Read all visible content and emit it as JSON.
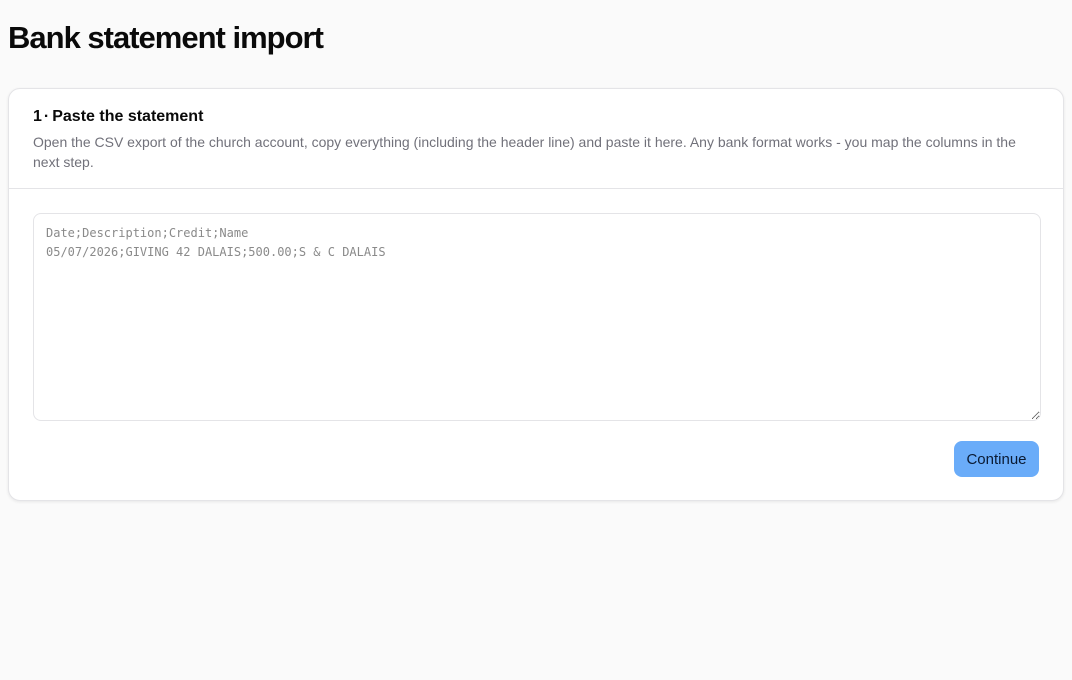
{
  "page": {
    "title": "Bank statement import"
  },
  "step": {
    "number": "1",
    "separator": "·",
    "title": "Paste the statement",
    "description": "Open the CSV export of the church account, copy everything (including the header line) and paste it here. Any bank format works - you map the columns in the next step."
  },
  "csv_input": {
    "value": "",
    "placeholder": "Date;Description;Credit;Name\n05/07/2026;GIVING 42 DALAIS;500.00;S & C DALAIS"
  },
  "actions": {
    "continue_label": "Continue"
  },
  "colors": {
    "primary_button": "#6aacf9",
    "page_background": "#fafafa",
    "card_border": "#e4e4e7",
    "muted_text": "#71717a"
  }
}
